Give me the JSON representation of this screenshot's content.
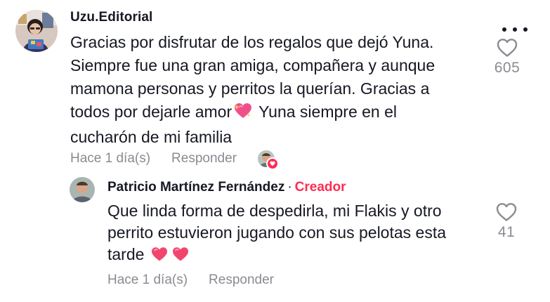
{
  "comment": {
    "username": "Uzu.Editorial",
    "text_lines": [
      "Gracias por disfrutar de los regalos que dejó Yuna.",
      "Siempre fue una gran amiga, compañera y aunque",
      "mamona personas y perritos la querían. Gracias a",
      "todos por dejarle amor",
      " Yuna siempre en el",
      "cucharón de mi familia"
    ],
    "emoji_sparkle_heart": "sparkling-heart-icon",
    "timestamp": "Hace 1 día(s)",
    "reply_label": "Responder",
    "like_count": "605"
  },
  "reply": {
    "username": "Patricio Martínez Fernández",
    "separator": "·",
    "badge": "Creador",
    "text_lines": [
      "Que linda forma de despedirla, mi Flakis y otro",
      "perrito estuvieron jugando con sus pelotas esta",
      "tarde"
    ],
    "emojis": [
      "heart-icon",
      "heart-icon"
    ],
    "timestamp": "Hace 1 día(s)",
    "reply_label": "Responder",
    "like_count": "41"
  },
  "colors": {
    "text": "#161823",
    "muted": "#8a8b91",
    "accent": "#fe2c55"
  }
}
